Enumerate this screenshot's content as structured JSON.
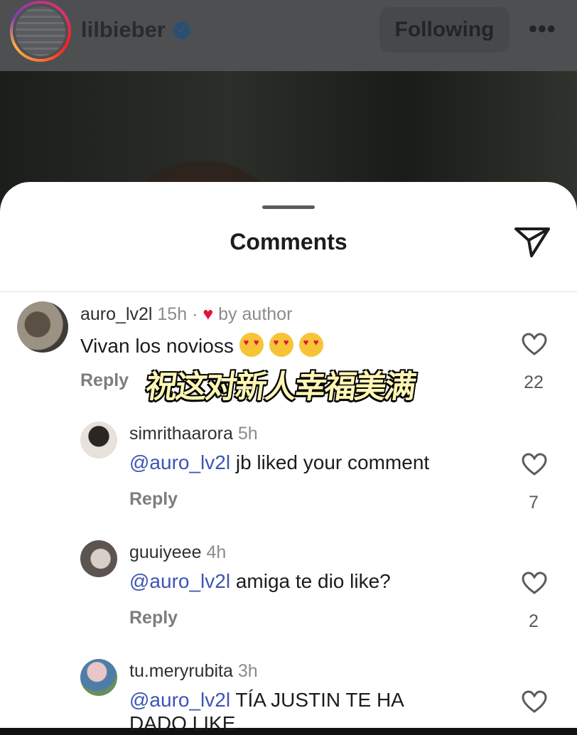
{
  "header": {
    "username": "lilbieber",
    "verified_mark": "✓",
    "follow_label": "Following",
    "more_label": "•••"
  },
  "sheet": {
    "title": "Comments"
  },
  "comments": [
    {
      "username": "auro_lv2l",
      "time": "15h",
      "separator": "·",
      "heart": "♥",
      "by_author": "by author",
      "text": "Vivan los novioss",
      "reply": "Reply",
      "likes": "22"
    },
    {
      "username": "simrithaarora",
      "time": "5h",
      "mention": "@auro_lv2l",
      "text": " jb liked your comment",
      "reply": "Reply",
      "likes": "7"
    },
    {
      "username": "guuiyeee",
      "time": "4h",
      "mention": "@auro_lv2l",
      "text": " amiga te dio like?",
      "reply": "Reply",
      "likes": "2"
    },
    {
      "username": "tu.meryrubita",
      "time": "3h",
      "mention": "@auro_lv2l",
      "text": " TÍA JUSTIN TE HA",
      "text_line2": "DADO LIKE"
    }
  ],
  "overlay_caption": "祝这对新人幸福美满",
  "colors": {
    "mention": "#3d55b3",
    "heart": "#e2133a",
    "header_bg": "#4d4f51"
  },
  "icons": [
    "verified-badge-icon",
    "more-icon",
    "share-send-icon",
    "heart-outline-icon",
    "heart-filled-icon",
    "heart-eyes-emoji"
  ]
}
